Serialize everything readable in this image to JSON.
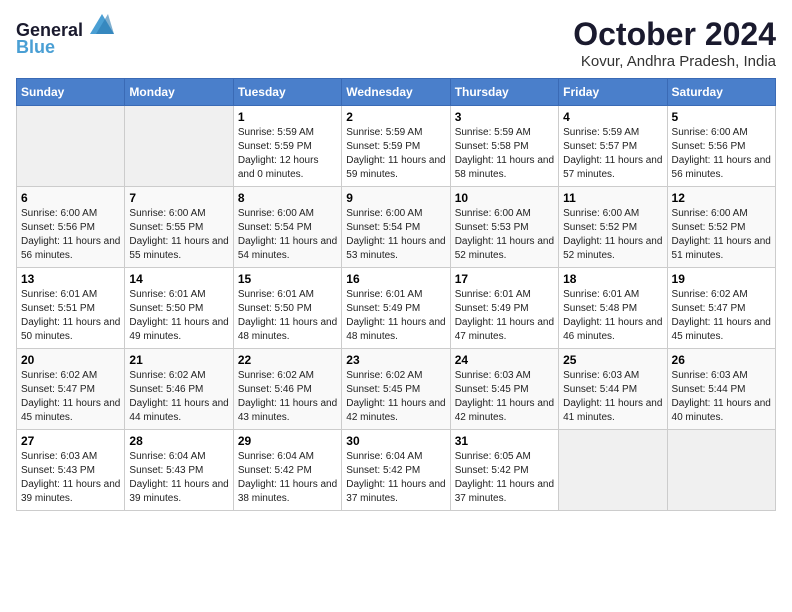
{
  "logo": {
    "line1": "General",
    "line2": "Blue"
  },
  "title": "October 2024",
  "subtitle": "Kovur, Andhra Pradesh, India",
  "headers": [
    "Sunday",
    "Monday",
    "Tuesday",
    "Wednesday",
    "Thursday",
    "Friday",
    "Saturday"
  ],
  "weeks": [
    [
      {
        "day": "",
        "info": ""
      },
      {
        "day": "",
        "info": ""
      },
      {
        "day": "1",
        "info": "Sunrise: 5:59 AM\nSunset: 5:59 PM\nDaylight: 12 hours and 0 minutes."
      },
      {
        "day": "2",
        "info": "Sunrise: 5:59 AM\nSunset: 5:59 PM\nDaylight: 11 hours and 59 minutes."
      },
      {
        "day": "3",
        "info": "Sunrise: 5:59 AM\nSunset: 5:58 PM\nDaylight: 11 hours and 58 minutes."
      },
      {
        "day": "4",
        "info": "Sunrise: 5:59 AM\nSunset: 5:57 PM\nDaylight: 11 hours and 57 minutes."
      },
      {
        "day": "5",
        "info": "Sunrise: 6:00 AM\nSunset: 5:56 PM\nDaylight: 11 hours and 56 minutes."
      }
    ],
    [
      {
        "day": "6",
        "info": "Sunrise: 6:00 AM\nSunset: 5:56 PM\nDaylight: 11 hours and 56 minutes."
      },
      {
        "day": "7",
        "info": "Sunrise: 6:00 AM\nSunset: 5:55 PM\nDaylight: 11 hours and 55 minutes."
      },
      {
        "day": "8",
        "info": "Sunrise: 6:00 AM\nSunset: 5:54 PM\nDaylight: 11 hours and 54 minutes."
      },
      {
        "day": "9",
        "info": "Sunrise: 6:00 AM\nSunset: 5:54 PM\nDaylight: 11 hours and 53 minutes."
      },
      {
        "day": "10",
        "info": "Sunrise: 6:00 AM\nSunset: 5:53 PM\nDaylight: 11 hours and 52 minutes."
      },
      {
        "day": "11",
        "info": "Sunrise: 6:00 AM\nSunset: 5:52 PM\nDaylight: 11 hours and 52 minutes."
      },
      {
        "day": "12",
        "info": "Sunrise: 6:00 AM\nSunset: 5:52 PM\nDaylight: 11 hours and 51 minutes."
      }
    ],
    [
      {
        "day": "13",
        "info": "Sunrise: 6:01 AM\nSunset: 5:51 PM\nDaylight: 11 hours and 50 minutes."
      },
      {
        "day": "14",
        "info": "Sunrise: 6:01 AM\nSunset: 5:50 PM\nDaylight: 11 hours and 49 minutes."
      },
      {
        "day": "15",
        "info": "Sunrise: 6:01 AM\nSunset: 5:50 PM\nDaylight: 11 hours and 48 minutes."
      },
      {
        "day": "16",
        "info": "Sunrise: 6:01 AM\nSunset: 5:49 PM\nDaylight: 11 hours and 48 minutes."
      },
      {
        "day": "17",
        "info": "Sunrise: 6:01 AM\nSunset: 5:49 PM\nDaylight: 11 hours and 47 minutes."
      },
      {
        "day": "18",
        "info": "Sunrise: 6:01 AM\nSunset: 5:48 PM\nDaylight: 11 hours and 46 minutes."
      },
      {
        "day": "19",
        "info": "Sunrise: 6:02 AM\nSunset: 5:47 PM\nDaylight: 11 hours and 45 minutes."
      }
    ],
    [
      {
        "day": "20",
        "info": "Sunrise: 6:02 AM\nSunset: 5:47 PM\nDaylight: 11 hours and 45 minutes."
      },
      {
        "day": "21",
        "info": "Sunrise: 6:02 AM\nSunset: 5:46 PM\nDaylight: 11 hours and 44 minutes."
      },
      {
        "day": "22",
        "info": "Sunrise: 6:02 AM\nSunset: 5:46 PM\nDaylight: 11 hours and 43 minutes."
      },
      {
        "day": "23",
        "info": "Sunrise: 6:02 AM\nSunset: 5:45 PM\nDaylight: 11 hours and 42 minutes."
      },
      {
        "day": "24",
        "info": "Sunrise: 6:03 AM\nSunset: 5:45 PM\nDaylight: 11 hours and 42 minutes."
      },
      {
        "day": "25",
        "info": "Sunrise: 6:03 AM\nSunset: 5:44 PM\nDaylight: 11 hours and 41 minutes."
      },
      {
        "day": "26",
        "info": "Sunrise: 6:03 AM\nSunset: 5:44 PM\nDaylight: 11 hours and 40 minutes."
      }
    ],
    [
      {
        "day": "27",
        "info": "Sunrise: 6:03 AM\nSunset: 5:43 PM\nDaylight: 11 hours and 39 minutes."
      },
      {
        "day": "28",
        "info": "Sunrise: 6:04 AM\nSunset: 5:43 PM\nDaylight: 11 hours and 39 minutes."
      },
      {
        "day": "29",
        "info": "Sunrise: 6:04 AM\nSunset: 5:42 PM\nDaylight: 11 hours and 38 minutes."
      },
      {
        "day": "30",
        "info": "Sunrise: 6:04 AM\nSunset: 5:42 PM\nDaylight: 11 hours and 37 minutes."
      },
      {
        "day": "31",
        "info": "Sunrise: 6:05 AM\nSunset: 5:42 PM\nDaylight: 11 hours and 37 minutes."
      },
      {
        "day": "",
        "info": ""
      },
      {
        "day": "",
        "info": ""
      }
    ]
  ]
}
